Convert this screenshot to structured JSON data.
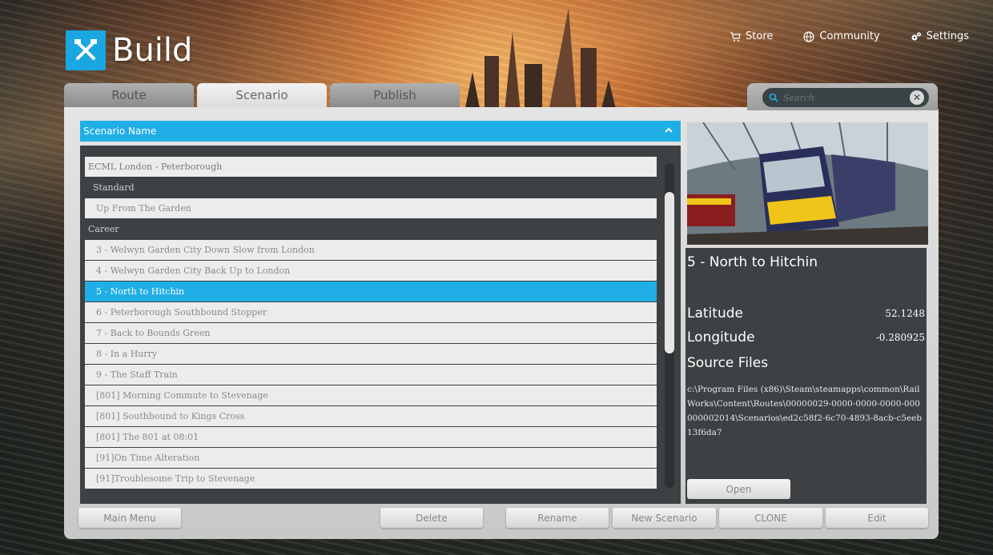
{
  "app": {
    "title": "Build"
  },
  "topnav": [
    {
      "label": "Store",
      "icon": "cart-icon"
    },
    {
      "label": "Community",
      "icon": "globe-icon"
    },
    {
      "label": "Settings",
      "icon": "gears-icon"
    }
  ],
  "tabs": [
    {
      "label": "Route",
      "active": false
    },
    {
      "label": "Scenario",
      "active": true
    },
    {
      "label": "Publish",
      "active": false
    }
  ],
  "search": {
    "placeholder": "Search"
  },
  "list": {
    "header": "Scenario Name",
    "rows": [
      {
        "text": "ECML London - Peterborough",
        "kind": "route"
      },
      {
        "text": "Standard",
        "kind": "group"
      },
      {
        "text": "Up From The Garden",
        "kind": "item"
      },
      {
        "text": "Career",
        "kind": "group"
      },
      {
        "text": "3 - Welwyn Garden City Down Slow from London",
        "kind": "item"
      },
      {
        "text": "4 - Welwyn Garden City Back Up to London",
        "kind": "item"
      },
      {
        "text": "5 - North to Hitchin",
        "kind": "item",
        "selected": true
      },
      {
        "text": "6 - Peterborough Southbound Stopper",
        "kind": "item"
      },
      {
        "text": "7 - Back to Bounds Green",
        "kind": "item"
      },
      {
        "text": "8 - In a Hurry",
        "kind": "item"
      },
      {
        "text": "9 - The Staff Train",
        "kind": "item"
      },
      {
        "text": "[801] Morning Commute to Stevenage",
        "kind": "item"
      },
      {
        "text": "[801] Southbound to Kings Cross",
        "kind": "item"
      },
      {
        "text": "[801] The 801 at 08:01",
        "kind": "item"
      },
      {
        "text": "[91]On Time Alteration",
        "kind": "item"
      },
      {
        "text": "[91]Troublesome Trip to Stevenage",
        "kind": "item"
      }
    ]
  },
  "details": {
    "title": "5 - North to Hitchin",
    "latitude_label": "Latitude",
    "latitude_value": "52.1248",
    "longitude_label": "Longitude",
    "longitude_value": "-0.280925",
    "source_label": "Source Files",
    "source_path": "c:\\Program Files (x86)\\Steam\\steamapps\\common\\RailWorks\\Content\\Routes\\00000029-0000-0000-0000-000000002014\\Scenarios\\ed2c58f2-6c70-4893-8acb-c5eeb13f6da7",
    "open_label": "Open"
  },
  "buttons": {
    "main_menu": "Main Menu",
    "delete": "Delete",
    "rename": "Rename",
    "new_scenario": "New Scenario",
    "clone": "CLONE",
    "edit": "Edit"
  },
  "colors": {
    "accent": "#20aee6",
    "panel_dark": "#3d4143"
  }
}
